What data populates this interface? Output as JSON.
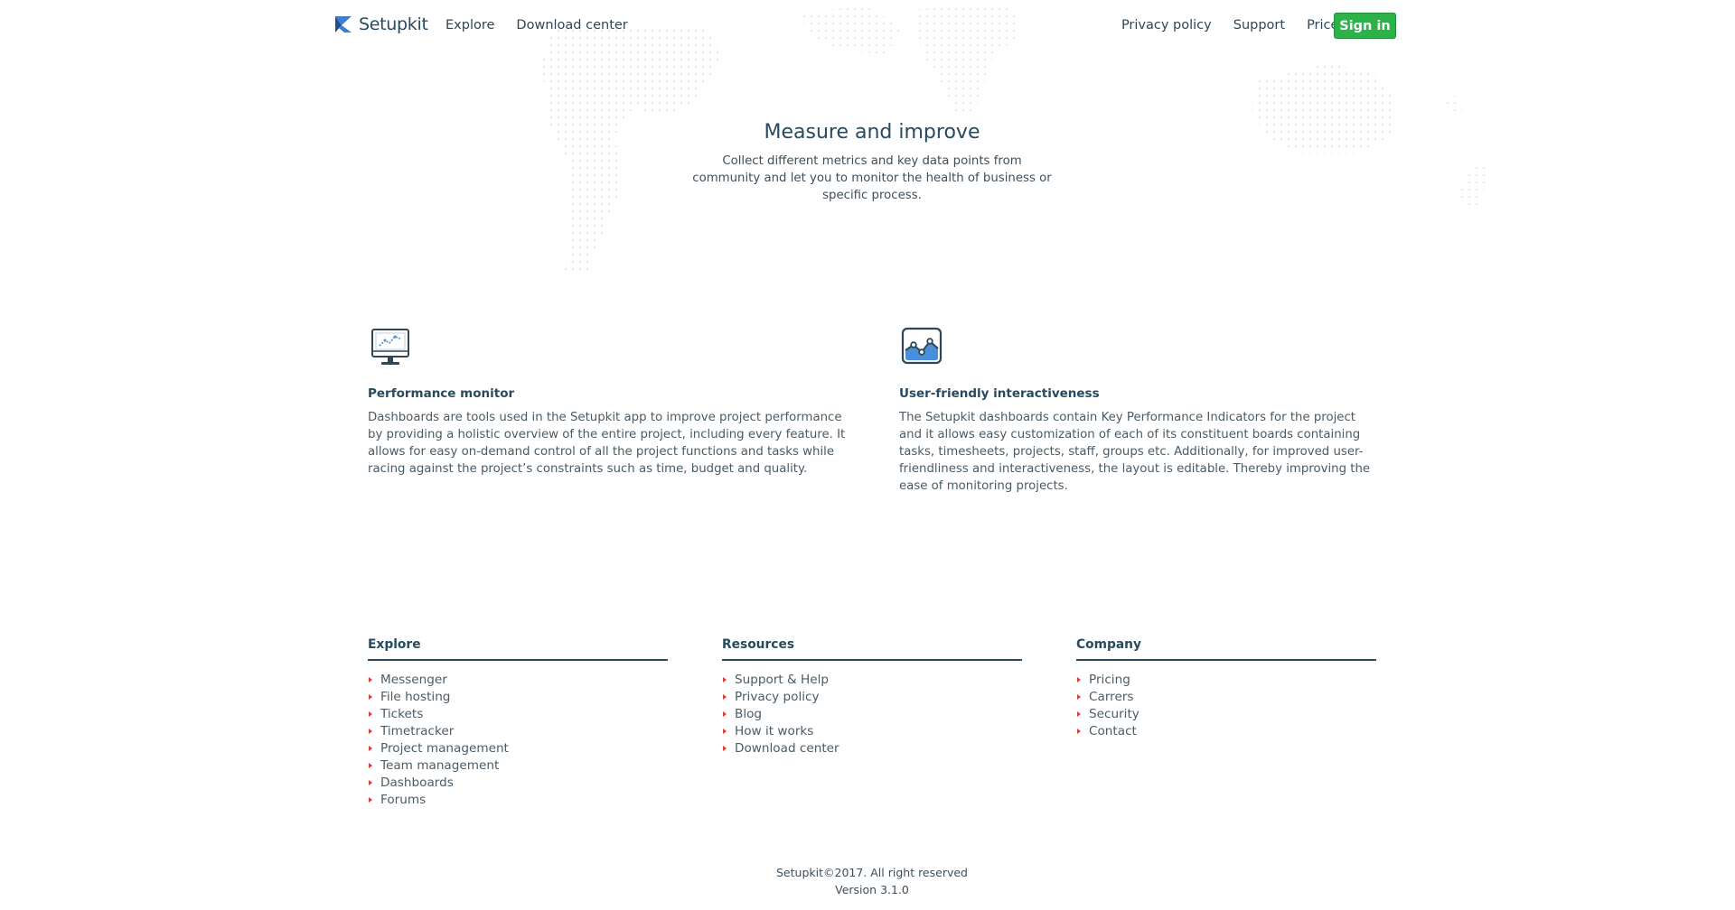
{
  "header": {
    "brand": "Setupkit",
    "nav_left": [
      "Explore",
      "Download center"
    ],
    "nav_right": [
      "Privacy policy",
      "Support",
      "Prices"
    ],
    "signin_label": "Sign in"
  },
  "hero": {
    "title": "Measure and improve",
    "text": "Collect different metrics and key data points from community and let you to monitor the health of business or specific process."
  },
  "features": [
    {
      "icon": "monitor-chart-icon",
      "title": "Performance monitor",
      "text": "Dashboards are tools used in the Setupkit app to improve project performance by providing a holistic overview of the entire project, including every feature. It allows for easy on-demand control of all the project functions and tasks while racing against the project’s constraints such as time, budget and quality."
    },
    {
      "icon": "area-chart-icon",
      "title": "User-friendly interactiveness",
      "text": "The Setupkit dashboards contain Key Performance Indicators for the project and it allows easy customization of each of its constituent boards containing tasks, timesheets, projects, staff, groups etc. Additionally, for improved user-friendliness and interactiveness, the layout is editable. Thereby improving the ease of monitoring projects."
    }
  ],
  "footer": {
    "columns": [
      {
        "title": "Explore",
        "links": [
          "Messenger",
          "File hosting",
          "Tickets",
          "Timetracker",
          "Project management",
          "Team management",
          "Dashboards",
          "Forums"
        ]
      },
      {
        "title": "Resources",
        "links": [
          "Support & Help",
          "Privacy policy",
          "Blog",
          "How it works",
          "Download center"
        ]
      },
      {
        "title": "Company",
        "links": [
          "Pricing",
          "Carrers",
          "Security",
          "Contact"
        ]
      }
    ],
    "copyright": "Setupkit©2017. All right reserved",
    "version": "Version 3.1.0"
  },
  "colors": {
    "signin_bg": "#2db24a",
    "heading": "#274a5f",
    "bullet": "#e23a2e"
  }
}
